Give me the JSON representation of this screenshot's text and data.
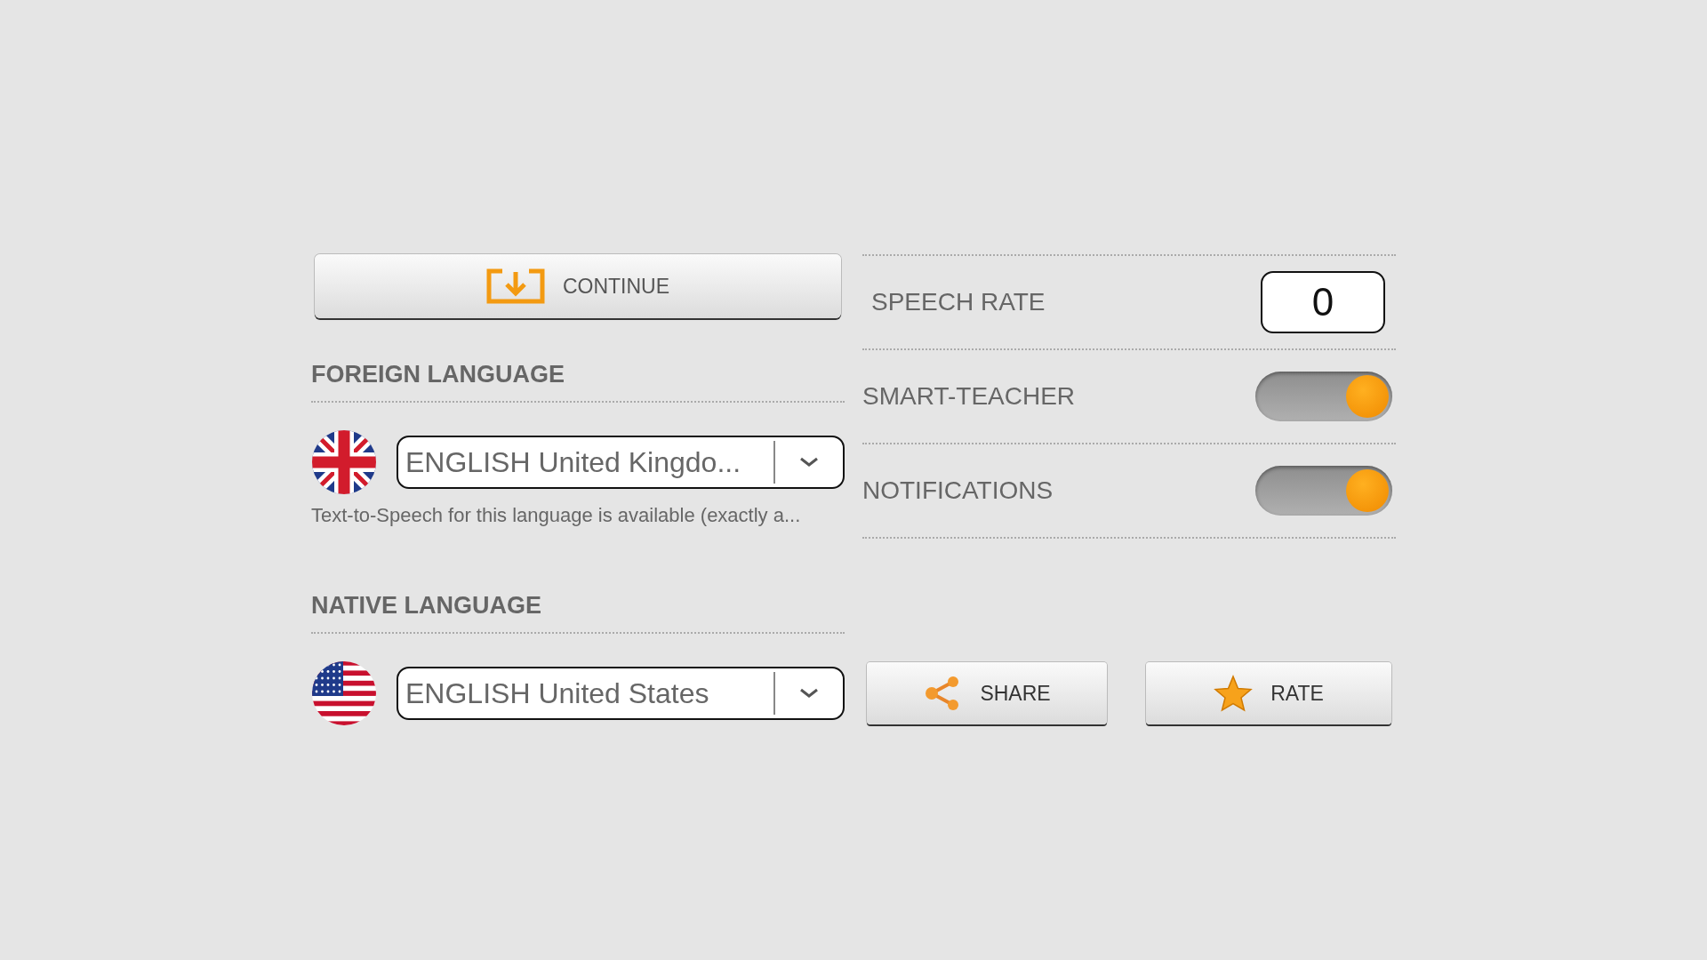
{
  "continue_button": {
    "label": "CONTINUE"
  },
  "foreign_language": {
    "heading": "FOREIGN LANGUAGE",
    "kind": "uk",
    "value": "ENGLISH United Kingdo...",
    "note": "Text-to-Speech for this language is available (exactly a..."
  },
  "native_language": {
    "heading": "NATIVE LANGUAGE",
    "kind": "us",
    "value": "ENGLISH United States"
  },
  "settings": [
    {
      "kind": "number",
      "label": "SPEECH RATE",
      "value": "0"
    },
    {
      "kind": "toggle",
      "label": "SMART-TEACHER",
      "on": true
    },
    {
      "kind": "toggle",
      "label": "NOTIFICATIONS",
      "on": true
    }
  ],
  "buttons": [
    {
      "kind": "share",
      "label": "SHARE"
    },
    {
      "kind": "rate",
      "label": "RATE"
    }
  ]
}
